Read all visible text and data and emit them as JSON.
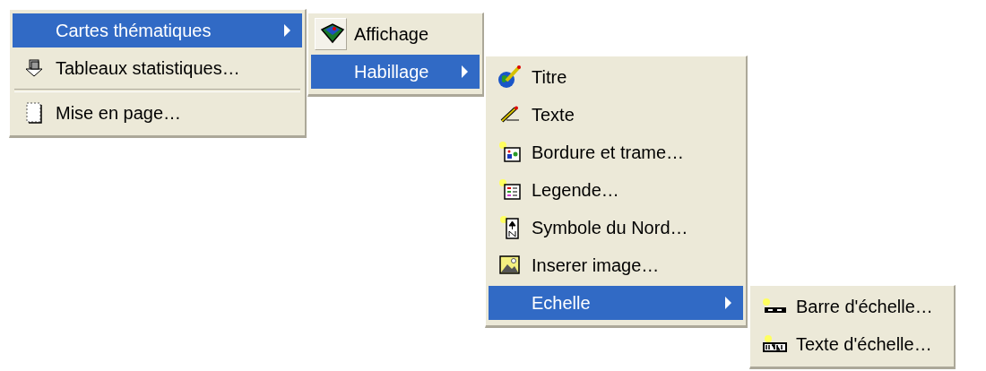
{
  "menus": [
    {
      "items": [
        {
          "kind": "submenu",
          "label": "Cartes thématiques",
          "selected": true
        },
        {
          "kind": "command",
          "label": "Tableaux statistiques…",
          "selected": false
        },
        {
          "kind": "separator"
        },
        {
          "kind": "command",
          "label": "Mise en page…",
          "selected": false
        }
      ]
    },
    {
      "items": [
        {
          "kind": "command",
          "label": "Affichage",
          "selected": false,
          "checked": true
        },
        {
          "kind": "submenu",
          "label": "Habillage",
          "selected": true,
          "checked": false
        }
      ]
    },
    {
      "items": [
        {
          "kind": "command",
          "label": "Titre",
          "selected": false
        },
        {
          "kind": "command",
          "label": "Texte",
          "selected": false
        },
        {
          "kind": "command",
          "label": "Bordure et trame…",
          "selected": false
        },
        {
          "kind": "command",
          "label": "Legende…",
          "selected": false
        },
        {
          "kind": "command",
          "label": "Symbole du Nord…",
          "selected": false
        },
        {
          "kind": "command",
          "label": "Inserer image…",
          "selected": false
        },
        {
          "kind": "submenu",
          "label": "Echelle",
          "selected": true
        }
      ]
    },
    {
      "items": [
        {
          "kind": "command",
          "label": "Barre d'échelle…",
          "selected": false
        },
        {
          "kind": "command",
          "label": "Texte d'échelle…",
          "selected": false
        }
      ]
    }
  ]
}
